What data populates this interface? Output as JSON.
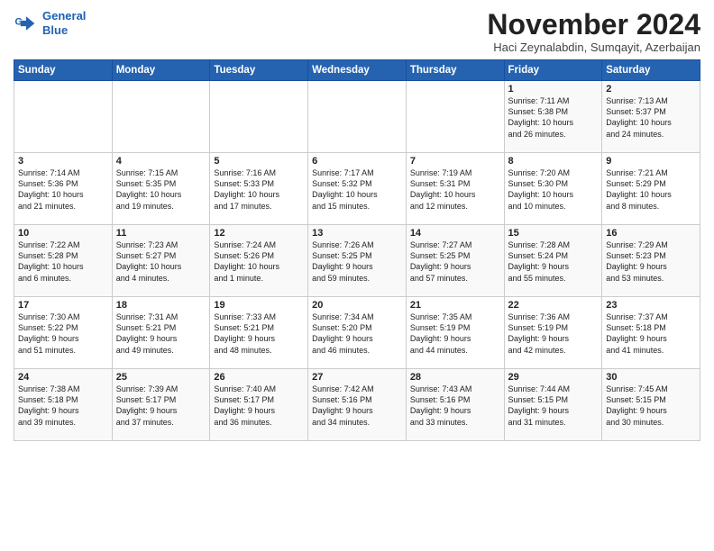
{
  "logo": {
    "line1": "General",
    "line2": "Blue"
  },
  "title": "November 2024",
  "location": "Haci Zeynalabdin, Sumqayit, Azerbaijan",
  "days_of_week": [
    "Sunday",
    "Monday",
    "Tuesday",
    "Wednesday",
    "Thursday",
    "Friday",
    "Saturday"
  ],
  "weeks": [
    [
      {
        "day": "",
        "info": ""
      },
      {
        "day": "",
        "info": ""
      },
      {
        "day": "",
        "info": ""
      },
      {
        "day": "",
        "info": ""
      },
      {
        "day": "",
        "info": ""
      },
      {
        "day": "1",
        "info": "Sunrise: 7:11 AM\nSunset: 5:38 PM\nDaylight: 10 hours\nand 26 minutes."
      },
      {
        "day": "2",
        "info": "Sunrise: 7:13 AM\nSunset: 5:37 PM\nDaylight: 10 hours\nand 24 minutes."
      }
    ],
    [
      {
        "day": "3",
        "info": "Sunrise: 7:14 AM\nSunset: 5:36 PM\nDaylight: 10 hours\nand 21 minutes."
      },
      {
        "day": "4",
        "info": "Sunrise: 7:15 AM\nSunset: 5:35 PM\nDaylight: 10 hours\nand 19 minutes."
      },
      {
        "day": "5",
        "info": "Sunrise: 7:16 AM\nSunset: 5:33 PM\nDaylight: 10 hours\nand 17 minutes."
      },
      {
        "day": "6",
        "info": "Sunrise: 7:17 AM\nSunset: 5:32 PM\nDaylight: 10 hours\nand 15 minutes."
      },
      {
        "day": "7",
        "info": "Sunrise: 7:19 AM\nSunset: 5:31 PM\nDaylight: 10 hours\nand 12 minutes."
      },
      {
        "day": "8",
        "info": "Sunrise: 7:20 AM\nSunset: 5:30 PM\nDaylight: 10 hours\nand 10 minutes."
      },
      {
        "day": "9",
        "info": "Sunrise: 7:21 AM\nSunset: 5:29 PM\nDaylight: 10 hours\nand 8 minutes."
      }
    ],
    [
      {
        "day": "10",
        "info": "Sunrise: 7:22 AM\nSunset: 5:28 PM\nDaylight: 10 hours\nand 6 minutes."
      },
      {
        "day": "11",
        "info": "Sunrise: 7:23 AM\nSunset: 5:27 PM\nDaylight: 10 hours\nand 4 minutes."
      },
      {
        "day": "12",
        "info": "Sunrise: 7:24 AM\nSunset: 5:26 PM\nDaylight: 10 hours\nand 1 minute."
      },
      {
        "day": "13",
        "info": "Sunrise: 7:26 AM\nSunset: 5:25 PM\nDaylight: 9 hours\nand 59 minutes."
      },
      {
        "day": "14",
        "info": "Sunrise: 7:27 AM\nSunset: 5:25 PM\nDaylight: 9 hours\nand 57 minutes."
      },
      {
        "day": "15",
        "info": "Sunrise: 7:28 AM\nSunset: 5:24 PM\nDaylight: 9 hours\nand 55 minutes."
      },
      {
        "day": "16",
        "info": "Sunrise: 7:29 AM\nSunset: 5:23 PM\nDaylight: 9 hours\nand 53 minutes."
      }
    ],
    [
      {
        "day": "17",
        "info": "Sunrise: 7:30 AM\nSunset: 5:22 PM\nDaylight: 9 hours\nand 51 minutes."
      },
      {
        "day": "18",
        "info": "Sunrise: 7:31 AM\nSunset: 5:21 PM\nDaylight: 9 hours\nand 49 minutes."
      },
      {
        "day": "19",
        "info": "Sunrise: 7:33 AM\nSunset: 5:21 PM\nDaylight: 9 hours\nand 48 minutes."
      },
      {
        "day": "20",
        "info": "Sunrise: 7:34 AM\nSunset: 5:20 PM\nDaylight: 9 hours\nand 46 minutes."
      },
      {
        "day": "21",
        "info": "Sunrise: 7:35 AM\nSunset: 5:19 PM\nDaylight: 9 hours\nand 44 minutes."
      },
      {
        "day": "22",
        "info": "Sunrise: 7:36 AM\nSunset: 5:19 PM\nDaylight: 9 hours\nand 42 minutes."
      },
      {
        "day": "23",
        "info": "Sunrise: 7:37 AM\nSunset: 5:18 PM\nDaylight: 9 hours\nand 41 minutes."
      }
    ],
    [
      {
        "day": "24",
        "info": "Sunrise: 7:38 AM\nSunset: 5:18 PM\nDaylight: 9 hours\nand 39 minutes."
      },
      {
        "day": "25",
        "info": "Sunrise: 7:39 AM\nSunset: 5:17 PM\nDaylight: 9 hours\nand 37 minutes."
      },
      {
        "day": "26",
        "info": "Sunrise: 7:40 AM\nSunset: 5:17 PM\nDaylight: 9 hours\nand 36 minutes."
      },
      {
        "day": "27",
        "info": "Sunrise: 7:42 AM\nSunset: 5:16 PM\nDaylight: 9 hours\nand 34 minutes."
      },
      {
        "day": "28",
        "info": "Sunrise: 7:43 AM\nSunset: 5:16 PM\nDaylight: 9 hours\nand 33 minutes."
      },
      {
        "day": "29",
        "info": "Sunrise: 7:44 AM\nSunset: 5:15 PM\nDaylight: 9 hours\nand 31 minutes."
      },
      {
        "day": "30",
        "info": "Sunrise: 7:45 AM\nSunset: 5:15 PM\nDaylight: 9 hours\nand 30 minutes."
      }
    ]
  ]
}
